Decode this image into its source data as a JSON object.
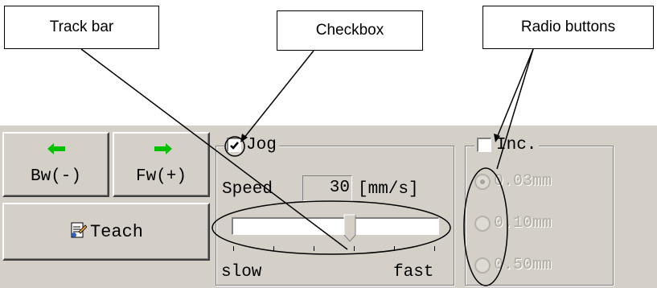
{
  "callouts": {
    "track_bar": "Track bar",
    "checkbox": "Checkbox",
    "radio_buttons": "Radio buttons"
  },
  "buttons": {
    "bw": {
      "label": "Bw(-)",
      "icon": "green-left-arrow-icon"
    },
    "fw": {
      "label": "Fw(+)",
      "icon": "green-right-arrow-icon"
    },
    "teach": {
      "label": "Teach",
      "icon": "teach-document-icon"
    }
  },
  "jog": {
    "label": "Jog",
    "checked": true,
    "speed_label": "Speed",
    "speed_value": "30",
    "speed_unit": "[mm/s]",
    "slider_min_label": "slow",
    "slider_max_label": "fast",
    "slider_level": 0.57
  },
  "inc": {
    "label": "Inc.",
    "checked": false,
    "options": [
      "0.03mm",
      "0.10mm",
      "0.50mm"
    ],
    "selected_index": 0,
    "enabled": false
  },
  "colors": {
    "panel_bg": "#d4d0c8",
    "arrow_green": "#00c000"
  }
}
